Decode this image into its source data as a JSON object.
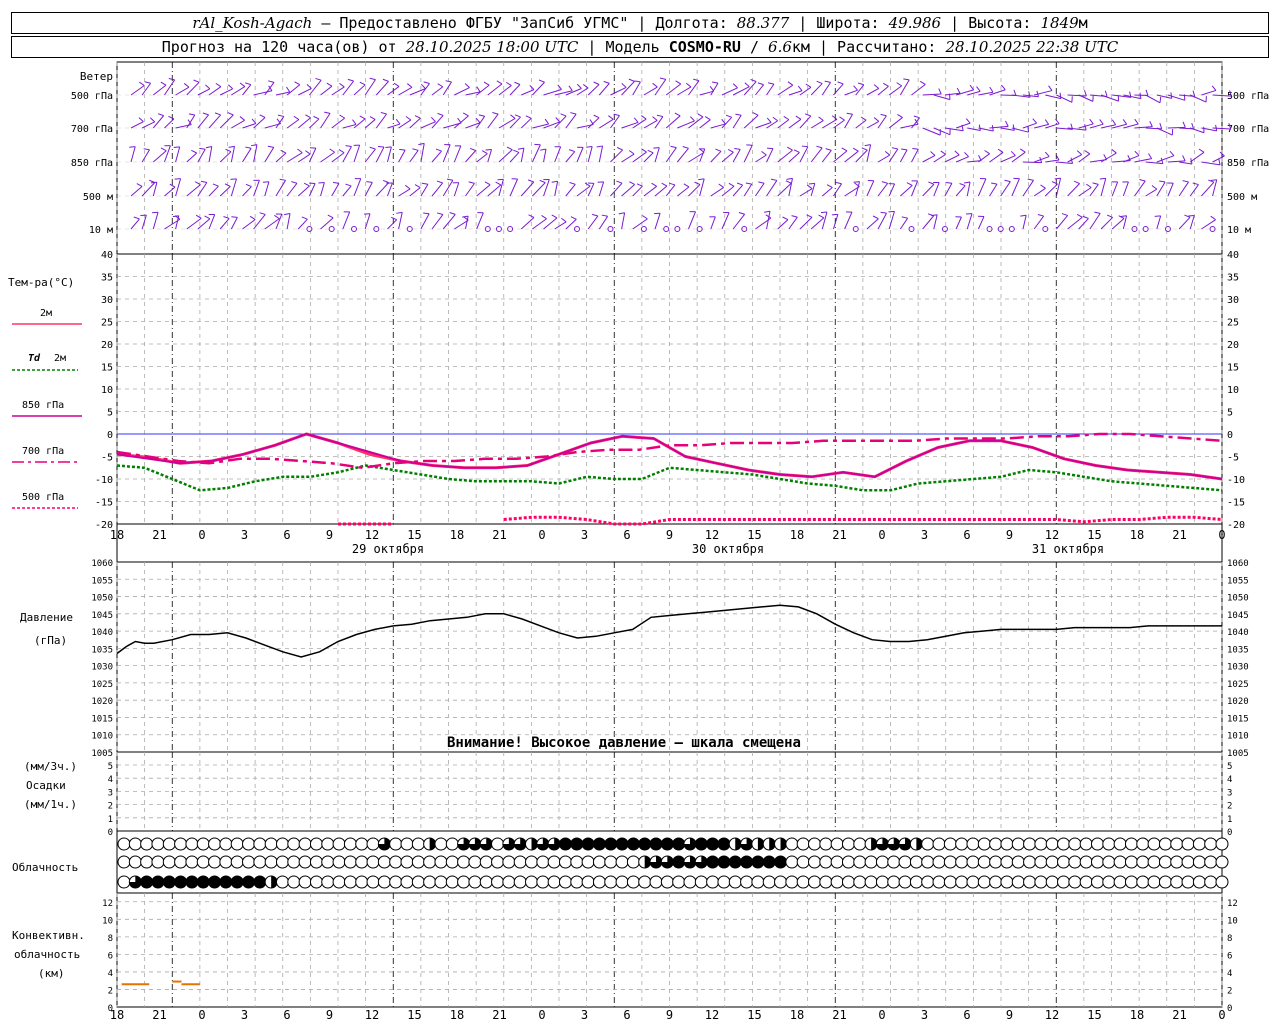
{
  "header": {
    "line1": {
      "station": "rAl_Kosh-Agach",
      "provider": " – Предоставлено ФГБУ \"ЗапСиб УГМС\" | Долгота: ",
      "lon": "88.377",
      "lat_label": " | Широта: ",
      "lat": "49.986",
      "alt_label": " | Высота: ",
      "alt": "1849",
      "alt_unit": "м"
    },
    "line2": {
      "forecast_label": "Прогноз на 120 часа(ов) от ",
      "start": "28.10.2025 18:00 UTC",
      "model_label": " | Модель ",
      "model": "COSMO-RU",
      "res_sep": " / ",
      "res": "6.6",
      "res_unit": "км",
      "calc_label": " | Рассчитано: ",
      "calc": "28.10.2025 22:38 UTC"
    }
  },
  "labels": {
    "wind": "Ветер",
    "wind_levels": [
      "500 гПа",
      "700 гПа",
      "850 гПа",
      "500 м",
      "10 м"
    ],
    "temp_title": "Тем-ра(°C)",
    "temp_2m": "2м",
    "td": "Td",
    "td_2m": "2м",
    "l850": "850 гПа",
    "l700": "700 гПа",
    "l500": "500 гПа",
    "pressure": "Давление",
    "pressure_unit": "(гПа)",
    "pressure_warning": "Внимание! Высокое давление – шкала смещена",
    "precip_unit3": "(мм/3ч.)",
    "precip": "Осадки",
    "precip_unit1": "(мм/1ч.)",
    "cloud": "Облачность",
    "conv1": "Конвективн.",
    "conv2": "облачность",
    "conv3": "(км)",
    "day_labels": [
      "29 октября",
      "30 октября",
      "31 октября"
    ]
  },
  "colors": {
    "t2m": "#ff3366",
    "td2m": "#008000",
    "t850": "#cc0099",
    "t700": "#e6007a",
    "t500": "#ff0066",
    "wind": "#7a1ad1",
    "pressure": "#000000",
    "conv": "#e67300",
    "zero_line": "#3333ff"
  },
  "chart_data": [
    {
      "type": "line",
      "name": "temperature",
      "x_hours": [
        0,
        3,
        6,
        9,
        12,
        15,
        18,
        21,
        24,
        27,
        30,
        33,
        36,
        39,
        42,
        45,
        48,
        51,
        54,
        57,
        60,
        63,
        66,
        69,
        72,
        75,
        78,
        81,
        84,
        87,
        90,
        93,
        96,
        99,
        102,
        105,
        108,
        111,
        114,
        117,
        120
      ],
      "x_tick_labels": [
        "18",
        "21",
        "0",
        "3",
        "6",
        "9",
        "12",
        "15",
        "18",
        "21",
        "0",
        "3",
        "6",
        "9",
        "12",
        "15",
        "18",
        "21",
        "0",
        "3",
        "6",
        "9",
        "12",
        "15",
        "18",
        "21",
        "0",
        "3",
        "6",
        "9",
        "12",
        "15",
        "18",
        "21",
        "0",
        "3",
        "6",
        "9",
        "12",
        "15",
        "18",
        "21",
        "0"
      ],
      "x_ticks_shown": [
        "18",
        "21",
        "0",
        "3",
        "6",
        "9",
        "12",
        "15",
        "18",
        "21",
        "0",
        "3",
        "6",
        "9",
        "12",
        "15",
        "18",
        "21",
        "0",
        "3",
        "6",
        "9",
        "12",
        "15",
        "18",
        "21",
        "0"
      ],
      "ylim": [
        -20,
        40
      ],
      "y_ticks": [
        40,
        35,
        30,
        25,
        20,
        15,
        10,
        5,
        0,
        -5,
        -10,
        -15,
        -20
      ],
      "series": [
        {
          "name": "2м",
          "values": [
            -4.5,
            -5.2,
            -6.5,
            -6.0,
            -4.5,
            -2.5,
            0,
            -2,
            -4.5,
            -6,
            -7,
            -7.5,
            -7.5,
            -7,
            -4.5,
            -2,
            -0.5,
            -1,
            -5,
            -6.5,
            -8,
            -9,
            -9.5,
            -8.5,
            -9.5,
            -6,
            -3,
            -1.5,
            -1.5,
            -3,
            -5.5,
            -7,
            -8,
            -8.5,
            -9,
            -10
          ]
        },
        {
          "name": "Td 2м",
          "values": [
            -7,
            -7.5,
            -10,
            -12.5,
            -12,
            -10.5,
            -9.5,
            -9.5,
            -8.5,
            -7,
            -8,
            -9,
            -10,
            -10.5,
            -10.5,
            -10.5,
            -11,
            -9.5,
            -10,
            -10,
            -7.5,
            -8,
            -8.5,
            -9,
            -10,
            -11,
            -11.5,
            -12.5,
            -12.5,
            -11,
            -10.5,
            -10,
            -9.5,
            -8,
            -8.5,
            -9.5,
            -10.5,
            -11,
            -11.5,
            -12,
            -12.5
          ]
        },
        {
          "name": "850 гПа",
          "values": [
            -4.5,
            -5.5,
            -6.5,
            -6.0,
            -4.5,
            -2.5,
            0,
            -2,
            -4,
            -6,
            -7,
            -7.5,
            -7.5,
            -7,
            -4.5,
            -2,
            -0.5,
            -1,
            -5,
            -6.5,
            -8,
            -9,
            -9.5,
            -8.5,
            -9.5,
            -6,
            -3,
            -1.5,
            -1.5,
            -3,
            -5.5,
            -7,
            -8,
            -8.5,
            -9,
            -10
          ]
        },
        {
          "name": "700 гПа",
          "values": [
            -4,
            -5,
            -6,
            -6.5,
            -5.5,
            -5.5,
            -6,
            -6.5,
            -7.5,
            -6.5,
            -6,
            -6,
            -5.5,
            -5.5,
            -5,
            -4,
            -3.5,
            -3.5,
            -2.5,
            -2.5,
            -2,
            -2,
            -2,
            -1.5,
            -1.5,
            -1.5,
            -1.5,
            -1,
            -1,
            -1,
            -0.5,
            -0.5,
            0,
            0,
            -0.5,
            -1,
            -1.5
          ]
        },
        {
          "name": "500 гПа",
          "values": [
            null,
            null,
            null,
            null,
            null,
            null,
            null,
            null,
            -20,
            -20,
            -20,
            null,
            null,
            null,
            -19,
            -18.5,
            -18.5,
            -19,
            -20,
            -20,
            -19,
            -19,
            -19,
            -19,
            -19,
            -19,
            -19,
            -19,
            -19,
            -19,
            -19,
            -19,
            -19,
            -19,
            -19,
            -19.5,
            -19,
            -19,
            -18.5,
            -18.5,
            -19
          ]
        }
      ]
    },
    {
      "type": "line",
      "name": "pressure",
      "ylim": [
        1005,
        1060
      ],
      "y_ticks": [
        1060,
        1055,
        1050,
        1045,
        1040,
        1035,
        1030,
        1025,
        1020,
        1015,
        1010,
        1005
      ],
      "x_hours": [
        0,
        1,
        2,
        3,
        4,
        6,
        8,
        10,
        12,
        14,
        16,
        18,
        20,
        22,
        24,
        26,
        28,
        30,
        32,
        34,
        36,
        38,
        40,
        42,
        44,
        46,
        48,
        50,
        52,
        54,
        56,
        58,
        60,
        62,
        64,
        66,
        68,
        70,
        72,
        74,
        76,
        78,
        80,
        82,
        84,
        86,
        88,
        90,
        92,
        94,
        96,
        98,
        100,
        102,
        104,
        106,
        108,
        110,
        112,
        114,
        116,
        118,
        120
      ],
      "values": [
        1033.5,
        1035.5,
        1037,
        1036.5,
        1036.5,
        1037.5,
        1039,
        1039,
        1039.5,
        1038,
        1036,
        1034,
        1032.5,
        1034,
        1037,
        1039,
        1040.5,
        1041.5,
        1042,
        1043,
        1043.5,
        1044,
        1045,
        1045,
        1043.5,
        1041.5,
        1039.5,
        1038,
        1038.5,
        1039.5,
        1040.5,
        1044,
        1044.5,
        1045,
        1045.5,
        1046,
        1046.5,
        1047,
        1047.5,
        1047,
        1045,
        1042,
        1039.5,
        1037.5,
        1037,
        1037,
        1037.5,
        1038.5,
        1039.5,
        1040,
        1040.5,
        1040.5,
        1040.5,
        1040.5,
        1041,
        1041,
        1041,
        1041,
        1041.5,
        1041.5,
        1041.5,
        1041.5,
        1041.5
      ]
    },
    {
      "type": "bar",
      "name": "precipitation",
      "ylim": [
        0,
        5
      ],
      "y_ticks": [
        5,
        4,
        3,
        2,
        1,
        0
      ],
      "values": []
    },
    {
      "type": "table",
      "name": "cloudiness",
      "rows": [
        {
          "name": "upper",
          "values": "000000000000000000000000000000000000000000000000000000000000000000000000000000000000000000000000000000000000000000000000"
        },
        {
          "name": "middle",
          "values": "000000000000000000000000000000000000000000000000000000000000000000000000000000000000000000000000000000000000000000000000"
        },
        {
          "name": "lower",
          "values": "000000000000000000000000000000000000000000000000000000000000000000000000000000000000000000000000000000000000000000000000"
        }
      ],
      "cells": {
        "upper": [
          0,
          0,
          0,
          0,
          0,
          0,
          0,
          0,
          0,
          0,
          0,
          0,
          0,
          0,
          0,
          0,
          0,
          0,
          0,
          0,
          0,
          0,
          0,
          2,
          0,
          0,
          0,
          1,
          0,
          0,
          2,
          2,
          2,
          0,
          2,
          2,
          1,
          2,
          2,
          3,
          3,
          3,
          3,
          3,
          3,
          3,
          3,
          3,
          3,
          3,
          2,
          3,
          3,
          3,
          1,
          2,
          1,
          1,
          1,
          0,
          0,
          0,
          0,
          0,
          0,
          0,
          1,
          2,
          2,
          2,
          1,
          0,
          0,
          0,
          0,
          0,
          0,
          0,
          0,
          0,
          0,
          0,
          0,
          0,
          0,
          0,
          0,
          0,
          0,
          0,
          0,
          0,
          0,
          0,
          0,
          0,
          0,
          0
        ],
        "middle": [
          0,
          0,
          0,
          0,
          0,
          0,
          0,
          0,
          0,
          0,
          0,
          0,
          0,
          0,
          0,
          0,
          0,
          0,
          0,
          0,
          0,
          0,
          0,
          0,
          0,
          0,
          0,
          0,
          0,
          0,
          0,
          0,
          0,
          0,
          0,
          0,
          0,
          0,
          0,
          0,
          0,
          0,
          0,
          0,
          0,
          0,
          1,
          2,
          2,
          3,
          2,
          2,
          3,
          3,
          3,
          3,
          3,
          3,
          3,
          0,
          0,
          0,
          0,
          0,
          0,
          0,
          0,
          0,
          0,
          0,
          0,
          0,
          0,
          0,
          0,
          0,
          0,
          0,
          0,
          0,
          0,
          0,
          0,
          0,
          0,
          0,
          0,
          0,
          0,
          0,
          0,
          0,
          0,
          0,
          0,
          0,
          0,
          0
        ],
        "lower": [
          0,
          2,
          3,
          3,
          3,
          3,
          3,
          3,
          3,
          3,
          3,
          3,
          3,
          1,
          0,
          0,
          0,
          0,
          0,
          0,
          0,
          0,
          0,
          0,
          0,
          0,
          0,
          0,
          0,
          0,
          0,
          0,
          0,
          0,
          0,
          0,
          0,
          0,
          0,
          0,
          0,
          0,
          0,
          0,
          0,
          0,
          0,
          0,
          0,
          0,
          0,
          0,
          0,
          0,
          0,
          0,
          0,
          0,
          0,
          0,
          0,
          0,
          0,
          0,
          0,
          0,
          0,
          0,
          0,
          0,
          0,
          0,
          0,
          0,
          0,
          0,
          0,
          0,
          0,
          0,
          0,
          0,
          0,
          0,
          0,
          0,
          0,
          0,
          0,
          0,
          0,
          0,
          0,
          0,
          0,
          0,
          0,
          0
        ]
      }
    },
    {
      "type": "line",
      "name": "convective cloudiness",
      "ylim": [
        0,
        13
      ],
      "y_ticks": [
        12,
        10,
        8,
        6,
        4,
        2,
        0
      ],
      "segments": [
        {
          "x0": 0.5,
          "x1": 3.5,
          "y": 2.6
        },
        {
          "x0": 6.0,
          "x1": 7.0,
          "y": 2.9
        },
        {
          "x0": 7.0,
          "x1": 9.0,
          "y": 2.6
        }
      ]
    }
  ]
}
